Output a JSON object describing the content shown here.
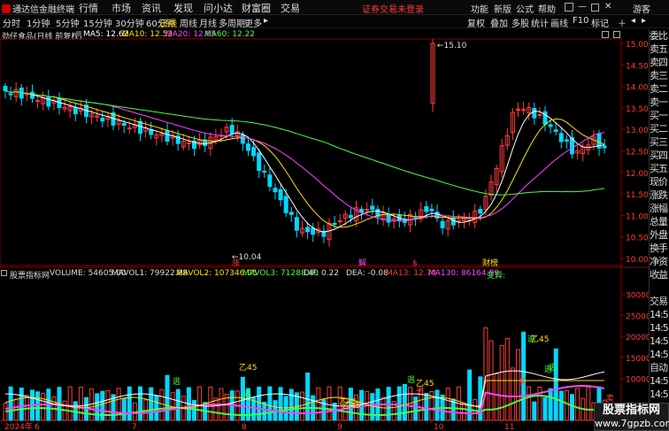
{
  "topbar": {
    "app_title": "通达信金融终端",
    "menus": [
      "行情",
      "市场",
      "资讯",
      "发现",
      "问小达",
      "财富圈",
      "交易"
    ],
    "alert": "证券交易未登录",
    "right_items": [
      "功能",
      "新版",
      "公式",
      "帮助"
    ],
    "guest": "游客"
  },
  "periodbar": {
    "periods": [
      "分时",
      "1分钟",
      "5分钟",
      "15分钟",
      "30分钟",
      "60分钟",
      "日线",
      "周线",
      "月线",
      "多周期",
      "更多"
    ],
    "active": "日线",
    "right": [
      "复权",
      "叠加",
      "多股",
      "统计",
      "画线",
      "F10",
      "标记"
    ]
  },
  "main": {
    "stock_title": "劲仔食品(日线 前复权)",
    "ma": [
      {
        "label": "MA5: 12.62",
        "color": "#ffffff"
      },
      {
        "label": "MA10: 12.53",
        "color": "#ffe000"
      },
      {
        "label": "MA20: 12.65",
        "color": "#ff44ff"
      },
      {
        "label": "MA60: 12.22",
        "color": "#44ff44"
      }
    ],
    "high_label": "15.10",
    "low_label": "10.04",
    "price_axis": [
      "15.00",
      "14.50",
      "14.00",
      "13.50",
      "13.00",
      "12.50",
      "12.00",
      "11.50",
      "11.00",
      "10.50",
      "10.00"
    ],
    "markers": [
      "涨",
      "解",
      "$",
      "财榜"
    ]
  },
  "sub": {
    "name": "股票指标网",
    "items": [
      {
        "label": "VOLUME: 54605.00",
        "color": "#dddddd"
      },
      {
        "label": "MAVOL1: 79922.88",
        "color": "#dddddd"
      },
      {
        "label": "MAVOL2: 107346.05",
        "color": "#ffe000"
      },
      {
        "label": "MAVOL3: 71288.40",
        "color": "#44ff44"
      },
      {
        "label": "DIF: 0.22",
        "color": "#dddddd"
      },
      {
        "label": "DEA: -0.08",
        "color": "#dddddd"
      },
      {
        "label": "MA13: 12.70",
        "color": "#ff3b3b"
      },
      {
        "label": "MA130: 86164.89",
        "color": "#ff44ff"
      },
      {
        "label": "变异:",
        "color": "#44ff44"
      }
    ],
    "vol_axis": [
      "30000",
      "25000",
      "20000",
      "15000",
      "10000"
    ],
    "signals": [
      "乙45",
      "逃",
      "逃",
      "乙45",
      "逃",
      "乙45",
      "逃",
      "乙45",
      "逃",
      "乙45",
      "买",
      "逃",
      "卖",
      "买"
    ],
    "date_labels": [
      "2024年",
      "6",
      "7",
      "8",
      "9",
      "10",
      "11"
    ]
  },
  "sidelist": [
    "委比",
    "卖五",
    "卖四",
    "卖三",
    "卖二",
    "卖一",
    "买一",
    "买二",
    "买三",
    "买四",
    "买五",
    "现价",
    "涨跌",
    "涨幅",
    "总量",
    "外盘",
    "换手",
    "净资",
    "收益",
    "",
    "交易",
    "14:5",
    "14:5",
    "14:5",
    "14:5",
    "自动",
    "14:5",
    "14:5",
    "14:5",
    "14:5",
    "14:5"
  ],
  "watermark": {
    "line1": "股票指标网",
    "line2": "www.7gpzb.com"
  },
  "colors": {
    "up": "#ff3b3b",
    "down": "#00d8ff",
    "ma60": "#44ff44",
    "background": "#000000"
  }
}
